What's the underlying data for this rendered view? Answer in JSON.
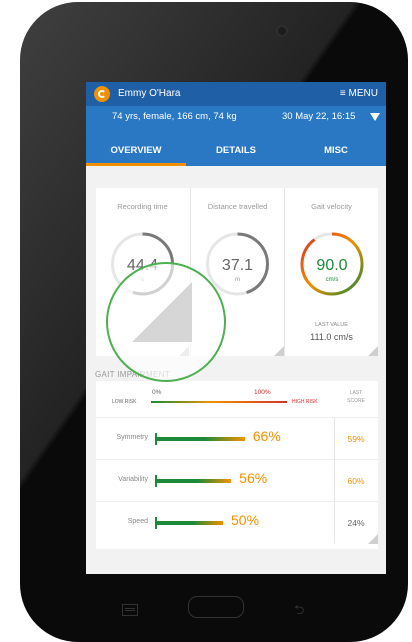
{
  "app": {
    "patient_name": "Emmy O'Hara",
    "menu_label": "MENU",
    "patient_info": "74 yrs, female, 166 cm, 74 kg",
    "session_datetime": "30 May 22, 16:15"
  },
  "tabs": [
    {
      "label": "OVERVIEW",
      "selected": true
    },
    {
      "label": "DETAILS",
      "selected": false
    },
    {
      "label": "MISC",
      "selected": false
    }
  ],
  "cards": [
    {
      "title": "Recording time",
      "value": "44.4",
      "unit": "s",
      "gauge_fraction": 0.55
    },
    {
      "title": "Distance travelled",
      "value": "37.1",
      "unit": "m",
      "gauge_fraction": 0.45
    },
    {
      "title": "Gait velocity",
      "value": "90.0",
      "unit": "cm/s",
      "gauge_fraction": 0.9,
      "last_value_label": "LAST VALUE",
      "last_value": "111.0 cm/s"
    }
  ],
  "gait": {
    "section_title": "GAIT IMPAIRMENT",
    "scale_min": "0%",
    "scale_max": "100%",
    "low_risk": "LOW RISK",
    "high_risk": "HIGH RISK",
    "last_score_label_1": "LAST",
    "last_score_label_2": "SCORE",
    "rows": [
      {
        "label": "Symmetry",
        "value": 66,
        "value_text": "66%",
        "last_score": "59%"
      },
      {
        "label": "Variability",
        "value": 56,
        "value_text": "56%",
        "last_score": "60%"
      },
      {
        "label": "Speed",
        "value": 50,
        "value_text": "50%",
        "last_score": "24%"
      }
    ]
  },
  "colors": {
    "app_bar": "#1f5fa6",
    "header": "#2a78c4",
    "accent_orange": "#f29100",
    "good_green": "#1b8a3a",
    "bad_red": "#d4302b",
    "highlight_circle": "#4cb050"
  },
  "icons": {
    "logo": "app-logo-icon",
    "menu": "hamburger-menu-icon",
    "dropdown": "dropdown-triangle-icon",
    "nav_recent": "recent-apps-icon",
    "nav_home": "home-button-icon",
    "nav_back": "back-arrow-icon"
  }
}
